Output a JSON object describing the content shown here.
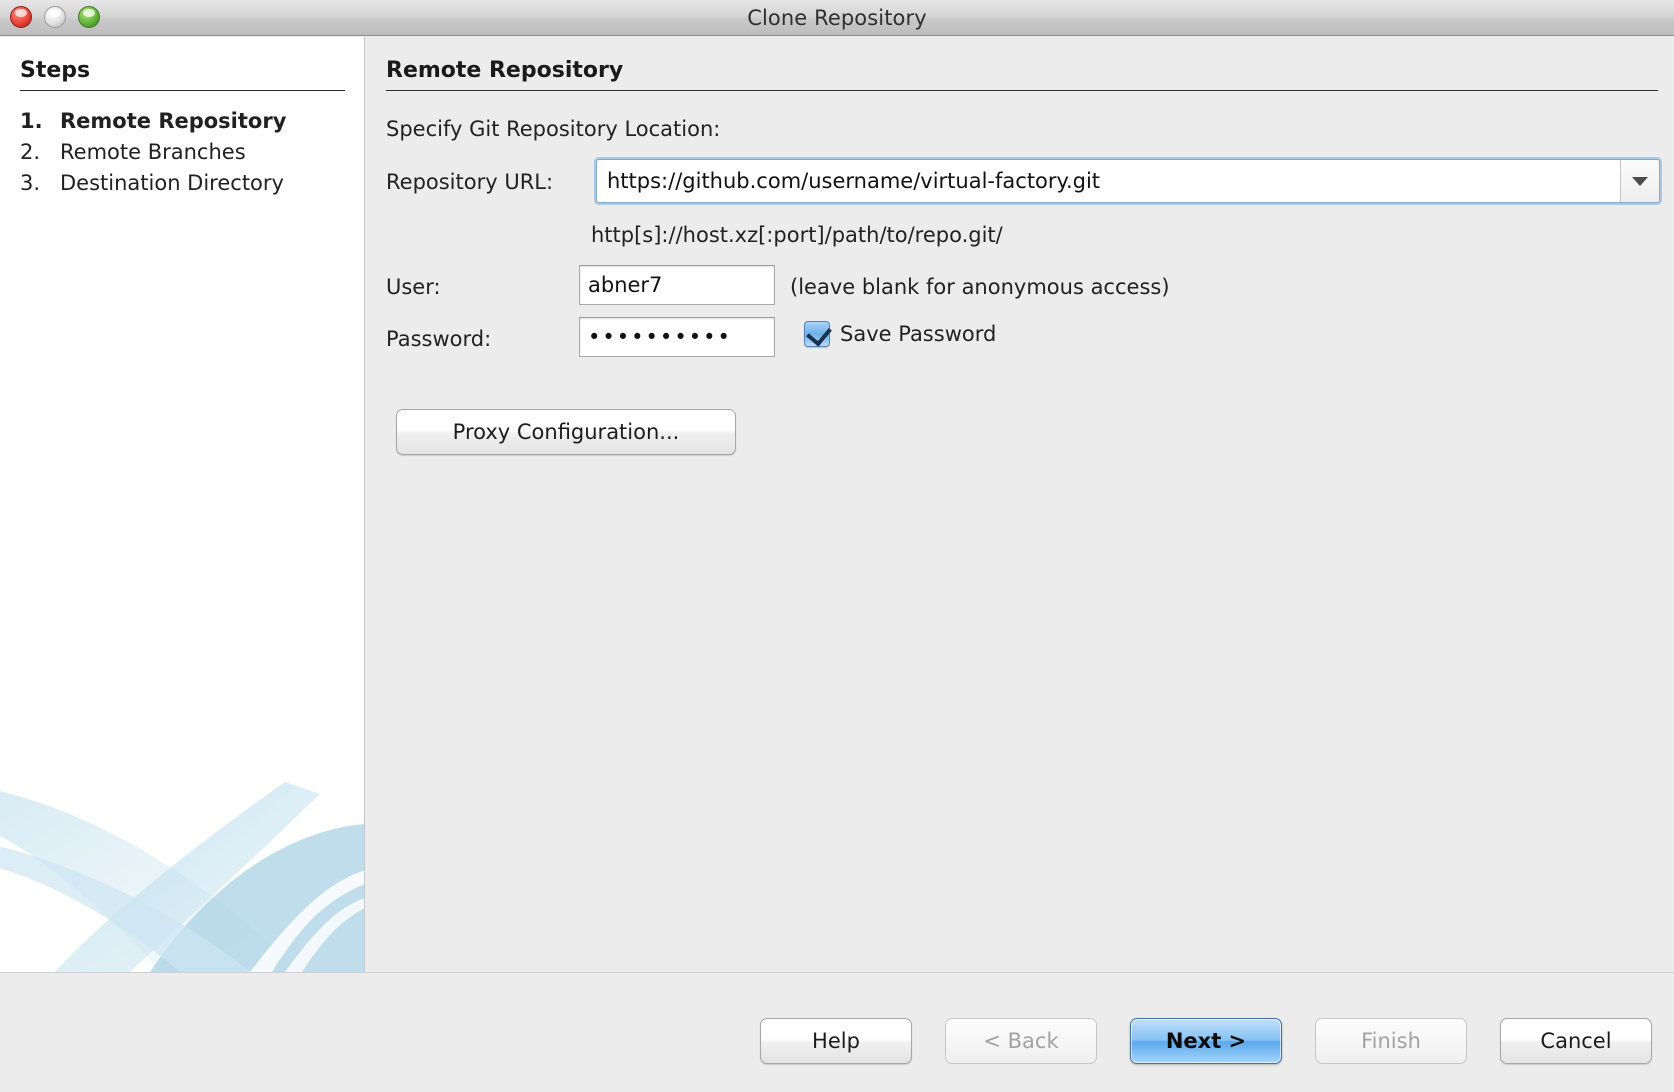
{
  "window": {
    "title": "Clone Repository",
    "traffic_lights": [
      "close-button",
      "minimize-button",
      "zoom-button"
    ]
  },
  "sidebar": {
    "heading": "Steps",
    "steps": [
      {
        "num": "1.",
        "label": "Remote Repository",
        "active": true
      },
      {
        "num": "2.",
        "label": "Remote Branches",
        "active": false
      },
      {
        "num": "3.",
        "label": "Destination Directory",
        "active": false
      }
    ]
  },
  "main": {
    "heading": "Remote Repository",
    "specify_label": "Specify Git Repository Location:",
    "url_label": "Repository URL:",
    "url_value": "https://github.com/username/virtual-factory.git",
    "url_hint": "http[s]://host.xz[:port]/path/to/repo.git/",
    "url_dropdown_icon": "chevron-down-icon",
    "user_label": "User:",
    "user_value": "abner7",
    "user_hint": "(leave blank for anonymous access)",
    "password_label": "Password:",
    "password_value": "••••••••••",
    "save_password_label": "Save Password",
    "save_password_checked": true,
    "proxy_button": "Proxy Configuration..."
  },
  "footer": {
    "buttons": [
      {
        "label": "Help",
        "state": "enabled"
      },
      {
        "label": "< Back",
        "state": "disabled"
      },
      {
        "label": "Next >",
        "state": "default"
      },
      {
        "label": "Finish",
        "state": "disabled"
      },
      {
        "label": "Cancel",
        "state": "enabled"
      }
    ]
  },
  "colors": {
    "window_bg": "#ececec",
    "sidebar_bg": "#ffffff",
    "accent_blue": "#5aa8ee",
    "focus_ring": "#78aadc",
    "swoosh": "#bddcea",
    "traffic_red": "#e8443a",
    "traffic_gray": "#e2e2e2",
    "traffic_green": "#62b43a"
  }
}
